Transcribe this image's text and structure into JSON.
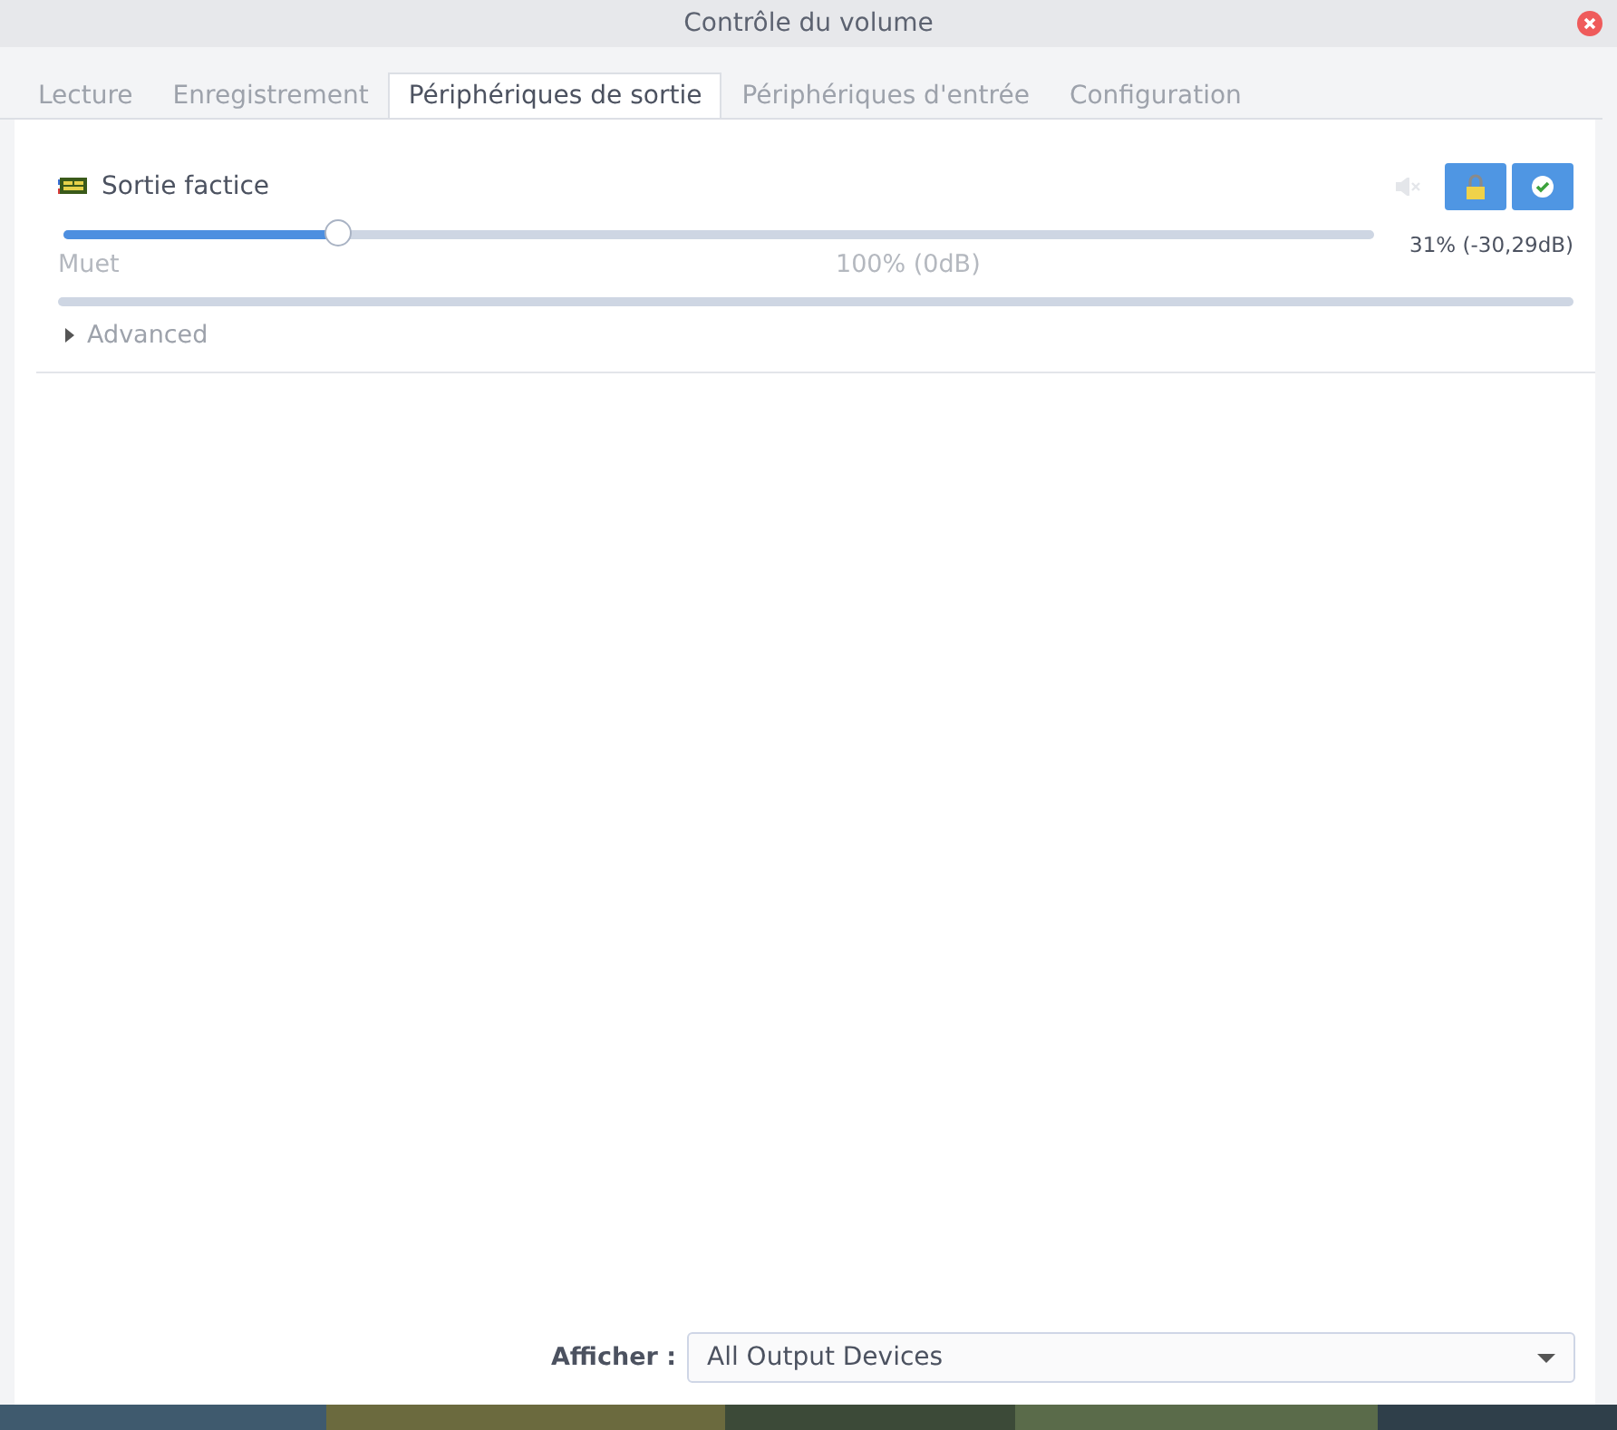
{
  "window": {
    "title": "Contrôle du volume"
  },
  "tabs": [
    {
      "label": "Lecture",
      "selected": false
    },
    {
      "label": "Enregistrement",
      "selected": false
    },
    {
      "label": "Périphériques de sortie",
      "selected": true
    },
    {
      "label": "Périphériques d'entrée",
      "selected": false
    },
    {
      "label": "Configuration",
      "selected": false
    }
  ],
  "devices": [
    {
      "name": "Sortie factice",
      "muted": false,
      "locked": true,
      "default": true,
      "level": 0.21,
      "reading": "31% (-30,29dB)",
      "scale_min": "Muet",
      "scale_mid": "100% (0dB)",
      "advanced": {
        "label": "Advanced",
        "expanded": false
      }
    }
  ],
  "filter": {
    "label": "Afficher :",
    "value": "All Output Devices"
  }
}
